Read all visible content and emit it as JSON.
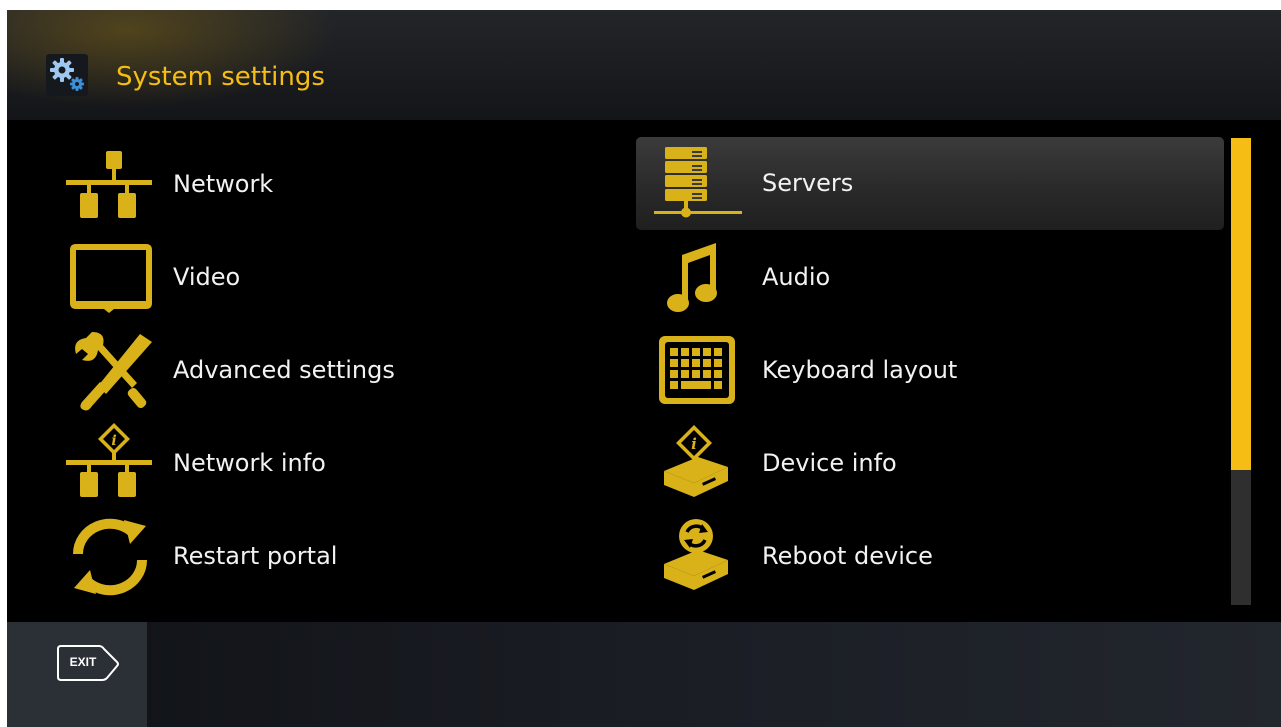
{
  "header": {
    "title": "System settings",
    "icon": "gears-icon"
  },
  "menu": {
    "left": [
      {
        "label": "Network",
        "icon": "network-icon"
      },
      {
        "label": "Video",
        "icon": "monitor-icon"
      },
      {
        "label": "Advanced settings",
        "icon": "tools-icon"
      },
      {
        "label": "Network info",
        "icon": "network-info-icon"
      },
      {
        "label": "Restart portal",
        "icon": "restart-icon"
      }
    ],
    "right": [
      {
        "label": "Servers",
        "icon": "servers-icon",
        "selected": true
      },
      {
        "label": "Audio",
        "icon": "music-note-icon"
      },
      {
        "label": "Keyboard layout",
        "icon": "keyboard-icon"
      },
      {
        "label": "Device info",
        "icon": "device-info-icon"
      },
      {
        "label": "Reboot device",
        "icon": "reboot-icon"
      }
    ]
  },
  "scrollbar": {
    "position_fraction": 0.0,
    "visible_fraction": 0.71
  },
  "footer": {
    "exit_label": "EXIT"
  },
  "colors": {
    "accent": "#f6be14",
    "icon_gold": "#d9b21a",
    "background": "#000000"
  }
}
